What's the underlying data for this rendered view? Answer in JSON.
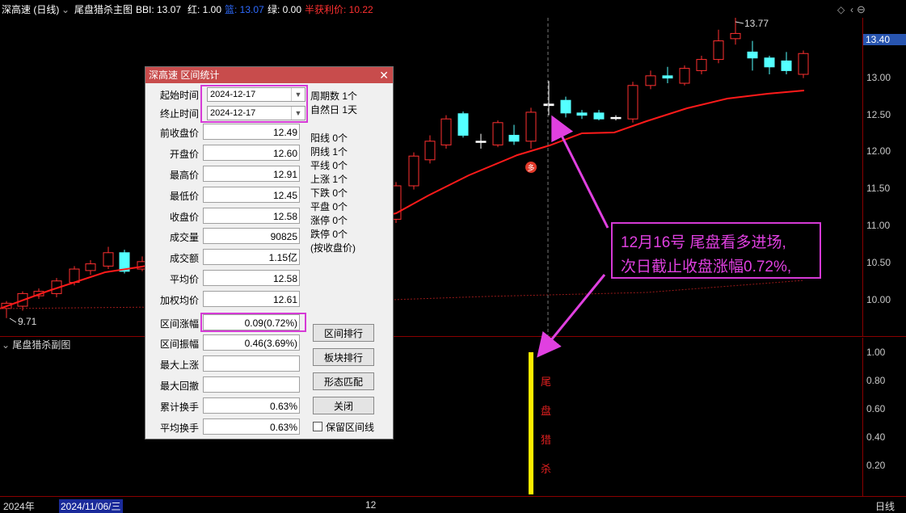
{
  "topbar": {
    "stock": "深高速 (日线)",
    "indicator": "尾盘猎杀主图",
    "bbi": "BBI: 13.07",
    "red": "红: 1.00",
    "blue": "篮: 13.07",
    "green": "绿: 0.00",
    "profit": "半获利价: 10.22"
  },
  "price_axis": {
    "current": "13.40",
    "ticks": [
      "13.00",
      "12.50",
      "12.00",
      "11.50",
      "11.00",
      "10.50",
      "10.00"
    ]
  },
  "chart_labels": {
    "high": "13.77",
    "low": "9.71"
  },
  "sub_pane": {
    "title": "尾盘猎杀副图",
    "ticks": [
      "1.00",
      "0.80",
      "0.60",
      "0.40",
      "0.20"
    ],
    "signal_chars": [
      "尾",
      "盘",
      "猎",
      "杀"
    ]
  },
  "bottom_bar": {
    "year": "2024年",
    "date": "2024/11/06/三",
    "month": "12",
    "period": "日线"
  },
  "dialog": {
    "title": "深高速 区间统计",
    "close": "✕",
    "start_label": "起始时间",
    "start_value": "2024-12-17",
    "end_label": "终止时间",
    "end_value": "2024-12-17",
    "period_count": "周期数 1个",
    "natural_days": "自然日 1天",
    "rows": [
      {
        "label": "前收盘价",
        "value": "12.49"
      },
      {
        "label": "开盘价",
        "value": "12.60"
      },
      {
        "label": "最高价",
        "value": "12.91"
      },
      {
        "label": "最低价",
        "value": "12.45"
      },
      {
        "label": "收盘价",
        "value": "12.58"
      },
      {
        "label": "成交量",
        "value": "90825"
      },
      {
        "label": "成交额",
        "value": "1.15亿"
      },
      {
        "label": "平均价",
        "value": "12.58"
      },
      {
        "label": "加权均价",
        "value": "12.61"
      },
      {
        "label": "区间涨幅",
        "value": "0.09(0.72%)"
      },
      {
        "label": "区间振幅",
        "value": "0.46(3.69%)"
      },
      {
        "label": "最大上涨",
        "value": ""
      },
      {
        "label": "最大回撤",
        "value": ""
      },
      {
        "label": "累计换手",
        "value": "0.63%"
      },
      {
        "label": "平均换手",
        "value": "0.63%"
      }
    ],
    "stats": [
      "阳线 0个",
      "阴线 1个",
      "平线 0个",
      "上涨 1个",
      "下跌 0个",
      "平盘 0个",
      "涨停 0个",
      "跌停 0个",
      "(按收盘价)"
    ],
    "buttons": {
      "range_rank": "区间排行",
      "sector_rank": "板块排行",
      "pattern_match": "形态匹配",
      "close": "关闭"
    },
    "keep_line": "保留区间线"
  },
  "annotation": {
    "line1": "12月16号 尾盘看多进场,",
    "line2": "次日截止收盘涨幅0.72%,"
  },
  "colors": {
    "up": "#ff3030",
    "down": "#54ffff",
    "ma": "#ff1a1a",
    "annot": "#e040e0",
    "signal": "#ffee00"
  }
}
